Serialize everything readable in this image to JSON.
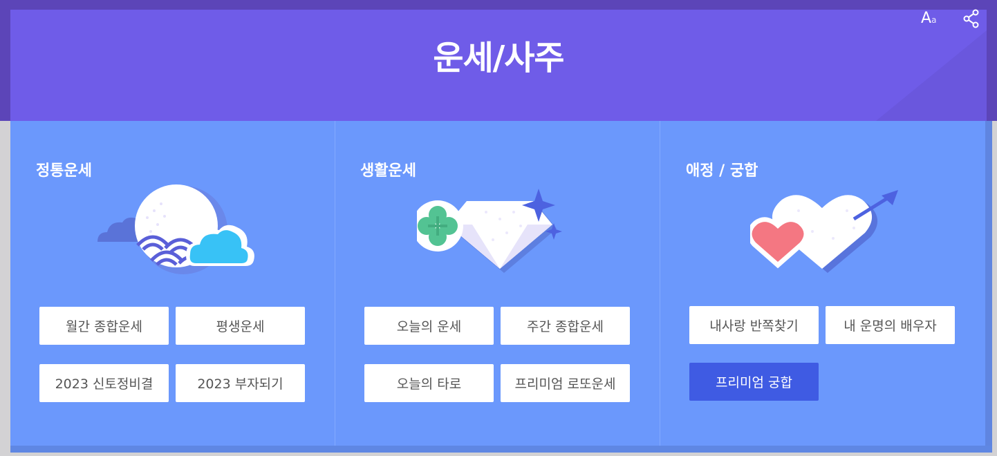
{
  "header": {
    "title": "운세/사주",
    "font_size_label_big": "A",
    "font_size_label_small": "a",
    "share_icon": "share-icon"
  },
  "colors": {
    "header_bg": "#6f5ce8",
    "panel_bg": "#6b98fc",
    "primary_button": "#3f5be3"
  },
  "categories": [
    {
      "title": "정통운세",
      "illustration": "moon-cloud-wave-icon",
      "buttons": [
        "월간 종합운세",
        "평생운세",
        "2023 신토정비결",
        "2023 부자되기"
      ]
    },
    {
      "title": "생활운세",
      "illustration": "diamond-clover-sparkle-icon",
      "buttons": [
        "오늘의 운세",
        "주간 종합운세",
        "오늘의 타로",
        "프리미엄 로또운세"
      ]
    },
    {
      "title": "애정 / 궁합",
      "illustration": "hearts-arrow-icon",
      "buttons": [
        "내사랑 반쪽찾기",
        "내 운명의 배우자",
        "프리미엄 궁합"
      ]
    }
  ]
}
